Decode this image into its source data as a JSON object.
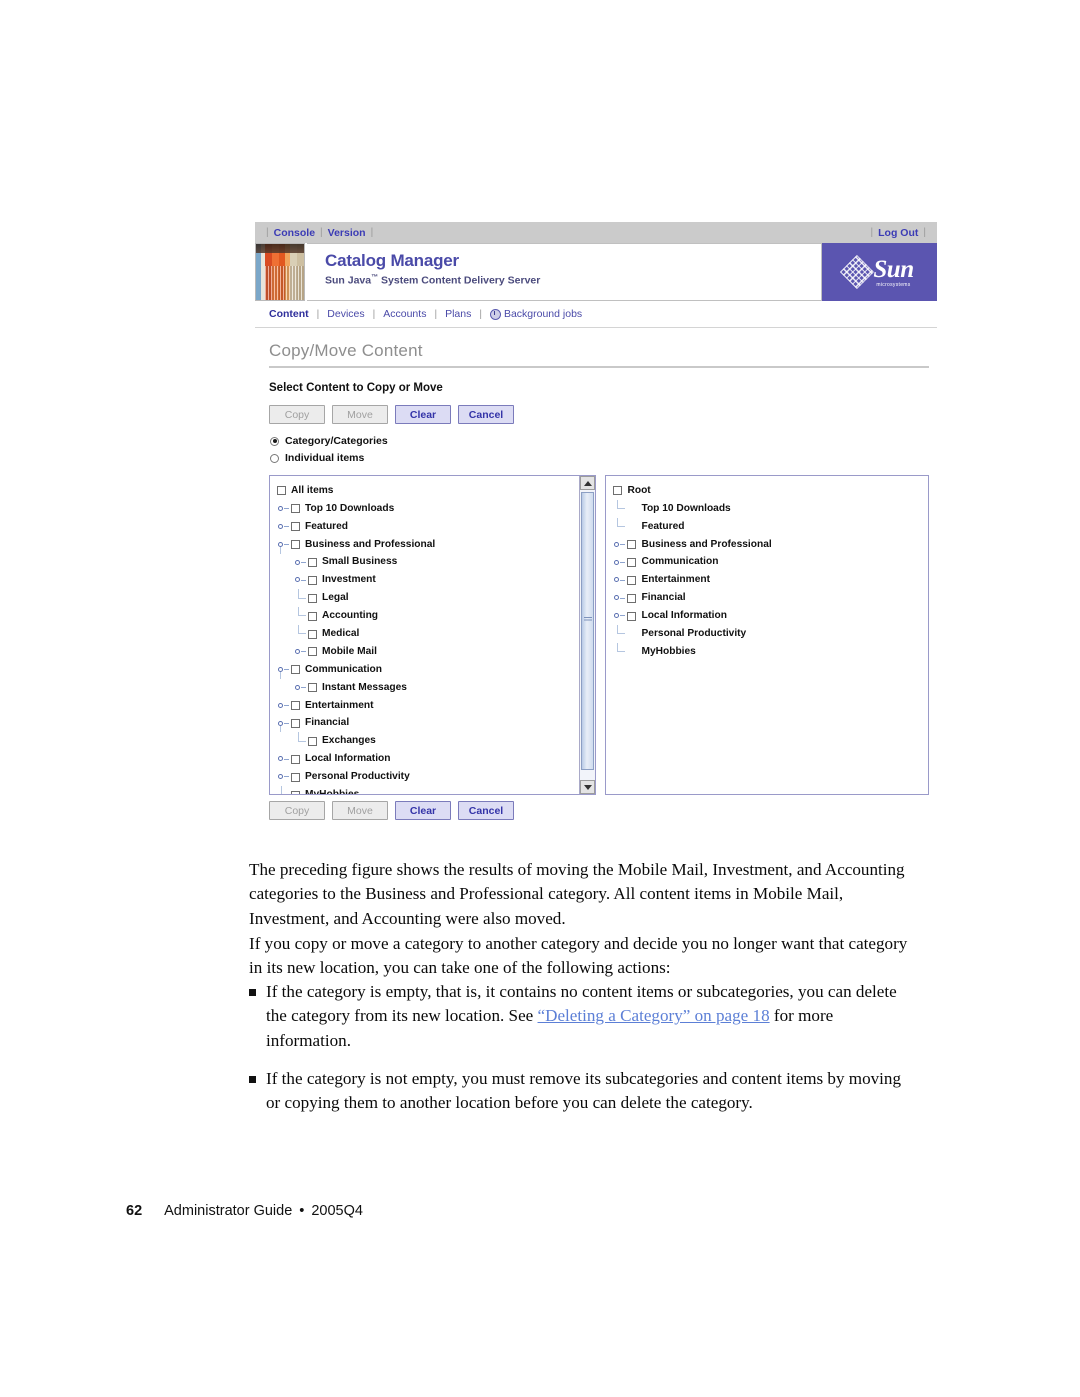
{
  "app": {
    "utility_bar": {
      "left_links": [
        "Console",
        "Version"
      ],
      "right_links": [
        "Log Out"
      ],
      "separator": "|"
    },
    "banner": {
      "title": "Catalog Manager",
      "subtitle_pre": "Sun Java",
      "subtitle_tm": "™",
      "subtitle_post": " System Content Delivery Server",
      "logo_text": "Sun",
      "logo_subtext": "microsystems",
      "logo_bg_color": "#5b55b0",
      "title_color": "#4a4aa8"
    },
    "tabs": [
      {
        "label": "Content",
        "active": true,
        "icon": null
      },
      {
        "label": "Devices",
        "active": false,
        "icon": null
      },
      {
        "label": "Accounts",
        "active": false,
        "icon": null
      },
      {
        "label": "Plans",
        "active": false,
        "icon": null
      },
      {
        "label": "Background jobs",
        "active": false,
        "icon": "clock-icon"
      }
    ],
    "page_heading": "Copy/Move Content",
    "section_title": "Select Content to Copy or Move",
    "buttons": [
      {
        "label": "Copy",
        "enabled": false
      },
      {
        "label": "Move",
        "enabled": false
      },
      {
        "label": "Clear",
        "enabled": true
      },
      {
        "label": "Cancel",
        "enabled": true
      }
    ],
    "radios": [
      {
        "label": "Category/Categories",
        "selected": true
      },
      {
        "label": "Individual items",
        "selected": false
      }
    ],
    "source_tree": {
      "has_scrollbar": true,
      "nodes": [
        {
          "label": "All items",
          "depth": 0,
          "checkbox": true,
          "handle": "none",
          "spine": false
        },
        {
          "label": "Top 10 Downloads",
          "depth": 1,
          "checkbox": true,
          "handle": "collapsed",
          "spine": false
        },
        {
          "label": "Featured",
          "depth": 1,
          "checkbox": true,
          "handle": "collapsed",
          "spine": false
        },
        {
          "label": "Business and Professional",
          "depth": 1,
          "checkbox": true,
          "handle": "expanded",
          "spine": true
        },
        {
          "label": "Small Business",
          "depth": 2,
          "checkbox": true,
          "handle": "collapsed",
          "spine": false
        },
        {
          "label": "Investment",
          "depth": 2,
          "checkbox": true,
          "handle": "collapsed",
          "spine": false
        },
        {
          "label": "Legal",
          "depth": 2,
          "checkbox": true,
          "handle": "leaf",
          "spine": false
        },
        {
          "label": "Accounting",
          "depth": 2,
          "checkbox": true,
          "handle": "leaf",
          "spine": false
        },
        {
          "label": "Medical",
          "depth": 2,
          "checkbox": true,
          "handle": "leaf",
          "spine": false
        },
        {
          "label": "Mobile Mail",
          "depth": 2,
          "checkbox": true,
          "handle": "collapsed",
          "spine": false
        },
        {
          "label": "Communication",
          "depth": 1,
          "checkbox": true,
          "handle": "expanded",
          "spine": true
        },
        {
          "label": "Instant Messages",
          "depth": 2,
          "checkbox": true,
          "handle": "collapsed",
          "spine": false
        },
        {
          "label": "Entertainment",
          "depth": 1,
          "checkbox": true,
          "handle": "collapsed",
          "spine": false
        },
        {
          "label": "Financial",
          "depth": 1,
          "checkbox": true,
          "handle": "expanded",
          "spine": true
        },
        {
          "label": "Exchanges",
          "depth": 2,
          "checkbox": true,
          "handle": "leaf",
          "spine": false
        },
        {
          "label": "Local Information",
          "depth": 1,
          "checkbox": true,
          "handle": "collapsed",
          "spine": false
        },
        {
          "label": "Personal Productivity",
          "depth": 1,
          "checkbox": true,
          "handle": "collapsed",
          "spine": false
        },
        {
          "label": "MyHobbies",
          "depth": 1,
          "checkbox": true,
          "handle": "leaf",
          "spine": false
        }
      ]
    },
    "destination_tree": {
      "has_scrollbar": false,
      "nodes": [
        {
          "label": "Root",
          "depth": 0,
          "checkbox": true,
          "handle": "none",
          "spine": false
        },
        {
          "label": "Top 10 Downloads",
          "depth": 1,
          "checkbox": false,
          "handle": "leaf",
          "spine": false
        },
        {
          "label": "Featured",
          "depth": 1,
          "checkbox": false,
          "handle": "leaf",
          "spine": false
        },
        {
          "label": "Business and Professional",
          "depth": 1,
          "checkbox": true,
          "handle": "collapsed",
          "spine": false
        },
        {
          "label": "Communication",
          "depth": 1,
          "checkbox": true,
          "handle": "collapsed",
          "spine": false
        },
        {
          "label": "Entertainment",
          "depth": 1,
          "checkbox": true,
          "handle": "collapsed",
          "spine": false
        },
        {
          "label": "Financial",
          "depth": 1,
          "checkbox": true,
          "handle": "collapsed",
          "spine": false
        },
        {
          "label": "Local Information",
          "depth": 1,
          "checkbox": true,
          "handle": "collapsed",
          "spine": false
        },
        {
          "label": "Personal Productivity",
          "depth": 1,
          "checkbox": false,
          "handle": "leaf",
          "spine": false
        },
        {
          "label": "MyHobbies",
          "depth": 1,
          "checkbox": false,
          "handle": "leaf",
          "spine": false
        }
      ]
    }
  },
  "document": {
    "paragraph_1": "The preceding figure shows the results of moving the Mobile Mail, Investment, and Accounting categories to the Business and Professional category. All content items in Mobile Mail, Investment, and Accounting were also moved.",
    "paragraph_2": "If you copy or move a category to another category and decide you no longer want that category in its new location, you can take one of the following actions:",
    "bullet_1_pre": "If the category is empty, that is, it contains no content items or subcategories, you can delete the category from its new location. See ",
    "bullet_1_link": "“Deleting a Category” on page 18",
    "bullet_1_post": " for more information.",
    "bullet_2": "If the category is not empty, you must remove its subcategories and content items by moving or copying them to another location before you can delete the category.",
    "link_color": "#5c7fd6"
  },
  "footer": {
    "page_number": "62",
    "guide_title": "Administrator Guide",
    "bullet": "•",
    "release": "2005Q4"
  }
}
